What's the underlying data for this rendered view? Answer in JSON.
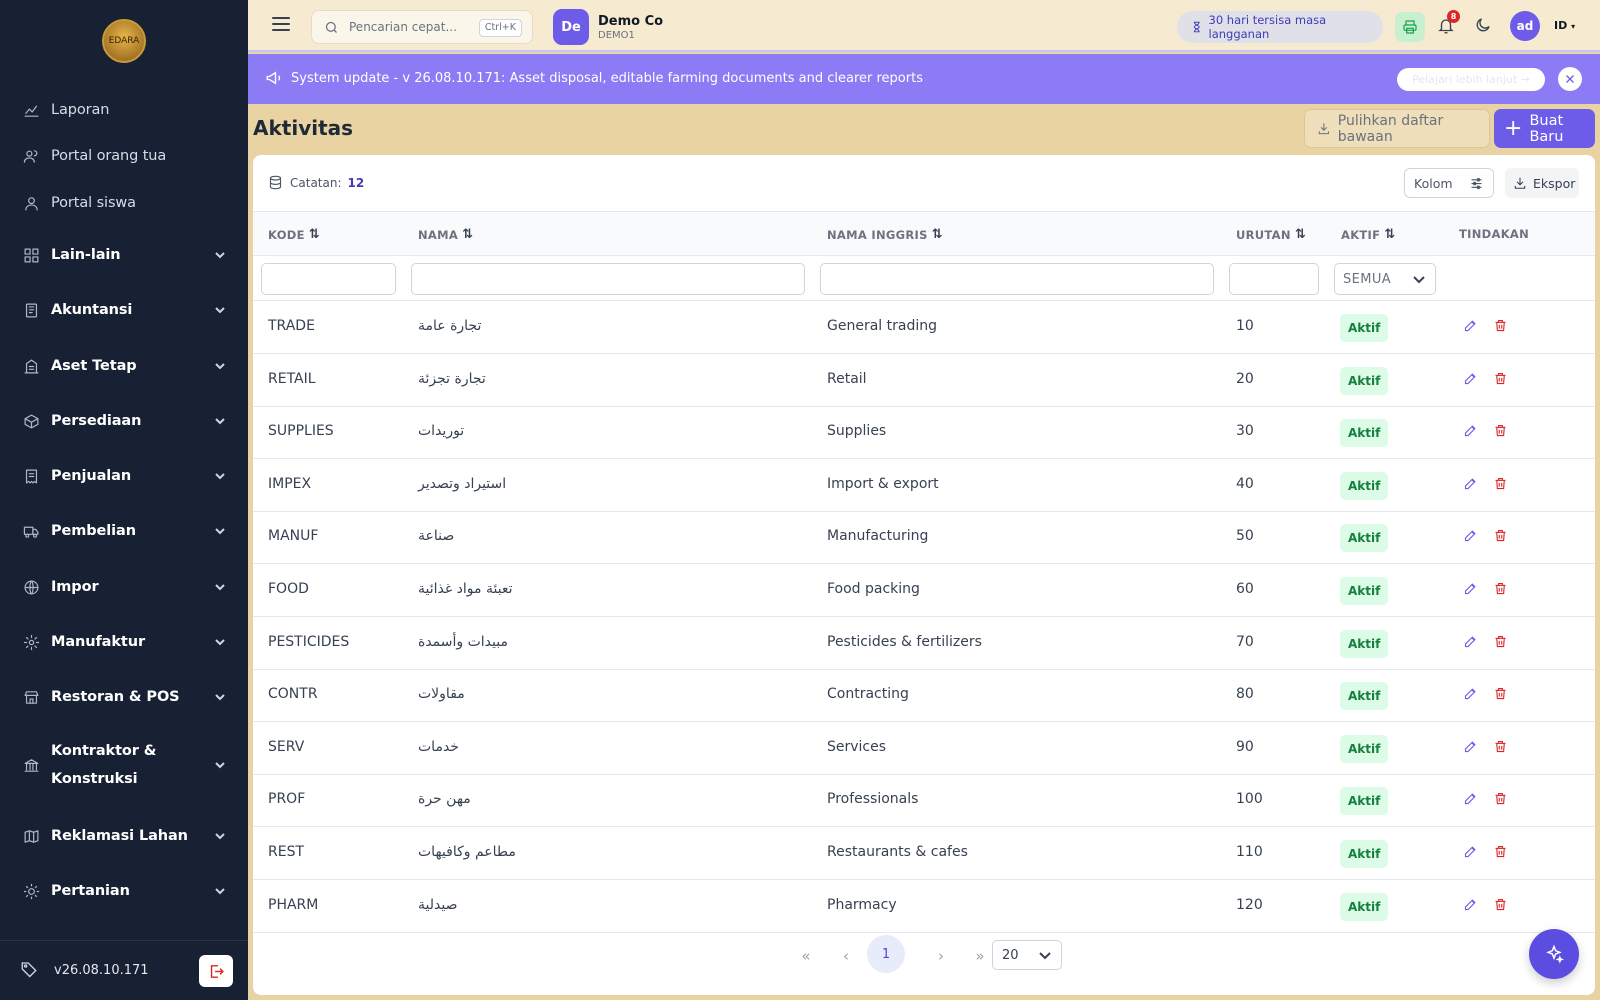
{
  "sidebar": {
    "logo_text": "EDARA",
    "items": [
      {
        "label": "Laporan",
        "icon": "chart-line-icon",
        "group": false
      },
      {
        "label": "Portal orang tua",
        "icon": "users-icon",
        "group": false
      },
      {
        "label": "Portal siswa",
        "icon": "user-icon",
        "group": false
      },
      {
        "label": "Lain-lain",
        "icon": "grid-icon",
        "group": true
      },
      {
        "label": "Akuntansi",
        "icon": "ledger-icon",
        "group": true
      },
      {
        "label": "Aset Tetap",
        "icon": "building-icon",
        "group": true
      },
      {
        "label": "Persediaan",
        "icon": "box-icon",
        "group": true
      },
      {
        "label": "Penjualan",
        "icon": "receipt-icon",
        "group": true
      },
      {
        "label": "Pembelian",
        "icon": "truck-icon",
        "group": true
      },
      {
        "label": "Impor",
        "icon": "globe-icon",
        "group": true
      },
      {
        "label": "Manufaktur",
        "icon": "cog-icon",
        "group": true
      },
      {
        "label": "Restoran & POS",
        "icon": "store-icon",
        "group": true
      },
      {
        "label": "Kontraktor & Konstruksi",
        "icon": "bank-icon",
        "group": true
      },
      {
        "label": "Reklamasi Lahan",
        "icon": "map-icon",
        "group": true
      },
      {
        "label": "Pertanian",
        "icon": "sun-icon",
        "group": true
      }
    ],
    "version": "v26.08.10.171"
  },
  "topbar": {
    "search_placeholder": "Pencarian cepat...",
    "shortcut": "Ctrl+K",
    "company_initials": "De",
    "company_name": "Demo Co",
    "company_code": "DEMO1",
    "subscription": "30 hari tersisa masa langganan",
    "notification_count": "8",
    "user_initials": "ad",
    "language": "ID"
  },
  "banner": {
    "message": "System update - v 26.08.10.171: Asset disposal, editable farming documents and clearer reports",
    "learn_more": "Pelajari lebih lanjut →"
  },
  "page": {
    "title": "Aktivitas",
    "restore_label": "Pulihkan daftar bawaan",
    "new_label": "Buat Baru"
  },
  "table": {
    "records_label": "Catatan:",
    "records_count": "12",
    "columns_label": "Kolom",
    "export_label": "Ekspor",
    "headers": {
      "code": "KODE",
      "name": "NAMA",
      "english_name": "NAMA INGGRIS",
      "order": "URUTAN",
      "active": "AKTIF",
      "actions": "TINDAKAN"
    },
    "active_filter": "SEMUA",
    "rows": [
      {
        "code": "TRADE",
        "name": "تجارة عامة",
        "english": "General trading",
        "order": "10",
        "status": "Aktif"
      },
      {
        "code": "RETAIL",
        "name": "تجارة تجزئة",
        "english": "Retail",
        "order": "20",
        "status": "Aktif"
      },
      {
        "code": "SUPPLIES",
        "name": "توريدات",
        "english": "Supplies",
        "order": "30",
        "status": "Aktif"
      },
      {
        "code": "IMPEX",
        "name": "استيراد وتصدير",
        "english": "Import & export",
        "order": "40",
        "status": "Aktif"
      },
      {
        "code": "MANUF",
        "name": "صناعة",
        "english": "Manufacturing",
        "order": "50",
        "status": "Aktif"
      },
      {
        "code": "FOOD",
        "name": "تعبئة مواد غذائية",
        "english": "Food packing",
        "order": "60",
        "status": "Aktif"
      },
      {
        "code": "PESTICIDES",
        "name": "مبيدات وأسمدة",
        "english": "Pesticides & fertilizers",
        "order": "70",
        "status": "Aktif"
      },
      {
        "code": "CONTR",
        "name": "مقاولات",
        "english": "Contracting",
        "order": "80",
        "status": "Aktif"
      },
      {
        "code": "SERV",
        "name": "خدمات",
        "english": "Services",
        "order": "90",
        "status": "Aktif"
      },
      {
        "code": "PROF",
        "name": "مهن حرة",
        "english": "Professionals",
        "order": "100",
        "status": "Aktif"
      },
      {
        "code": "REST",
        "name": "مطاعم وكافيهات",
        "english": "Restaurants & cafes",
        "order": "110",
        "status": "Aktif"
      },
      {
        "code": "PHARM",
        "name": "صيدلية",
        "english": "Pharmacy",
        "order": "120",
        "status": "Aktif"
      }
    ]
  },
  "pagination": {
    "current_page": "1",
    "page_size": "20"
  },
  "colors": {
    "sidebar_bg": "#182033",
    "accent": "#6d5ce8",
    "banner_bg": "#8b7cf6",
    "active_badge_bg": "#dcfce7",
    "active_badge_text": "#15803d",
    "delete": "#dc2626"
  }
}
